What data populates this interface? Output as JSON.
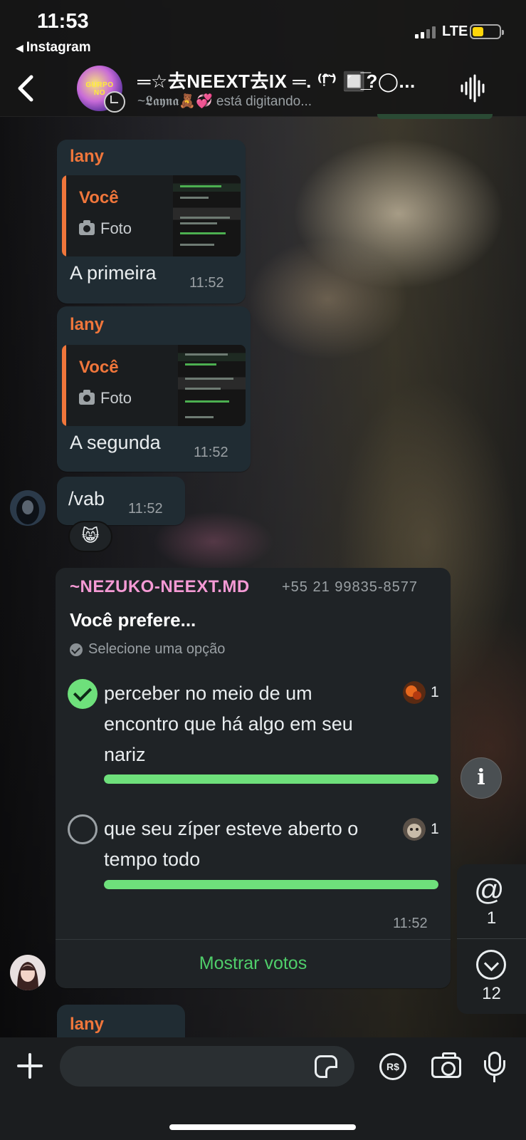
{
  "status_bar": {
    "time": "11:53",
    "back_app": "Instagram",
    "network": "LTE"
  },
  "header": {
    "group_name": "═☆去NEEXT去IX ═.   ⁽ᵎ᷄̂ ᷅⁾ 🔲̲̅?◯...",
    "typing": "~𝕷𝖆𝖞𝖓𝖆🧸💞 está digitando...",
    "avatar_text": "GURPO NO"
  },
  "messages": [
    {
      "sender": "lany",
      "quote_name": "Você",
      "quote_type": "Foto",
      "text": "A primeira",
      "time": "11:52"
    },
    {
      "sender": "lany",
      "quote_name": "Você",
      "quote_type": "Foto",
      "text": "A segunda",
      "time": "11:52"
    },
    {
      "text": "/vab",
      "time": "11:52",
      "reaction": "😸"
    }
  ],
  "poll": {
    "sender": "~NEZUKO-NEEXT.MD",
    "phone": "+55 21 99835-8577",
    "question": "Você prefere...",
    "hint": "Selecione uma opção",
    "options": [
      {
        "text": "perceber no meio de um encontro que há algo em seu nariz",
        "votes": "1",
        "selected": true,
        "fraction": 1.0
      },
      {
        "text": "que seu zíper esteve aberto o tempo todo",
        "votes": "1",
        "selected": false,
        "fraction": 1.0
      }
    ],
    "time": "11:52",
    "show_votes": "Mostrar votos"
  },
  "partial_message": {
    "sender": "lany"
  },
  "side": {
    "info": "i",
    "mention_symbol": "@",
    "mention_count": "1",
    "unread_count": "12"
  },
  "input": {
    "placeholder": "",
    "pay_label": "R$"
  },
  "colors": {
    "sender_orange": "#f0763b",
    "poll_sender_pink": "#f59ad5",
    "poll_green": "#6ee07b",
    "show_votes_green": "#4fce6a",
    "battery_yellow": "#ffd60a"
  }
}
